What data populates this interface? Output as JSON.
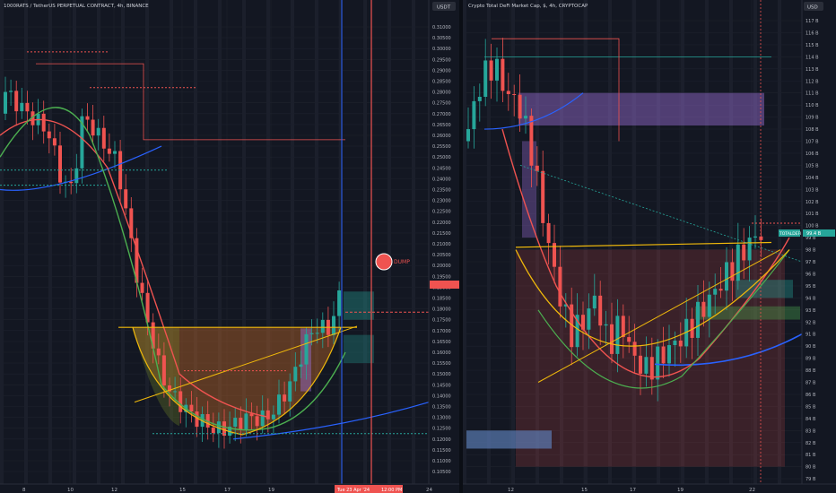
{
  "left_chart": {
    "title": "1000RATS / TetherUS PERPETUAL CONTRACT, 4h, BINANCE",
    "currency": "USDT",
    "price_ticks": [
      "0.31000",
      "0.30500",
      "0.30000",
      "0.29500",
      "0.29000",
      "0.28500",
      "0.28000",
      "0.27500",
      "0.27000",
      "0.26500",
      "0.26000",
      "0.25500",
      "0.25000",
      "0.24500",
      "0.24000",
      "0.23500",
      "0.23000",
      "0.22500",
      "0.22000",
      "0.21500",
      "0.21000",
      "0.20500",
      "0.20000",
      "0.19500",
      "0.19000",
      "0.18500",
      "0.18000",
      "0.17500",
      "0.17000",
      "0.16500",
      "0.16000",
      "0.15500",
      "0.15000",
      "0.14500",
      "0.14000",
      "0.13500",
      "0.13000",
      "0.12500",
      "0.12000",
      "0.11500",
      "0.11000",
      "0.10500"
    ],
    "time_ticks": [
      "8",
      "10",
      "12",
      "15",
      "17",
      "19",
      "22",
      "24"
    ],
    "crosshair_date": "Tue 23 Apr '24",
    "crosshair_time": "12:00 PM",
    "annotation": "DUMP",
    "current_price": "0.18500",
    "colors": {
      "up": "#26a69a",
      "down": "#ef5350",
      "accent": "#2962ff"
    }
  },
  "right_chart": {
    "title": "Crypto Total DeFi Market Cap, $, 4h, CRYPTOCAP",
    "currency": "USD",
    "price_ticks": [
      "117 B",
      "116 B",
      "115 B",
      "114 B",
      "113 B",
      "112 B",
      "111 B",
      "110 B",
      "109 B",
      "108 B",
      "107 B",
      "106 B",
      "105 B",
      "104 B",
      "103 B",
      "102 B",
      "101 B",
      "100 B",
      "99 B",
      "98 B",
      "97 B",
      "96 B",
      "95 B",
      "94 B",
      "93 B",
      "92 B",
      "91 B",
      "90 B",
      "89 B",
      "88 B",
      "87 B",
      "86 B",
      "85 B",
      "84 B",
      "83 B",
      "82 B",
      "81 B",
      "80 B",
      "79 B"
    ],
    "time_ticks": [
      "12",
      "15",
      "17",
      "19",
      "22"
    ],
    "symbol_badge": "TOTALDEFI",
    "badge_price": "99.4 B"
  },
  "chart_data": [
    {
      "type": "candlestick",
      "title": "1000RATS / TetherUS PERPETUAL CONTRACT, 4h, BINANCE",
      "ylabel": "USDT",
      "ylim": [
        0.105,
        0.31
      ],
      "x_ticks": [
        "8",
        "10",
        "12",
        "15",
        "17",
        "19",
        "22",
        "24"
      ],
      "series": [
        {
          "name": "close",
          "values": [
            0.28,
            0.275,
            0.27,
            0.266,
            0.26,
            0.24,
            0.235,
            0.27,
            0.262,
            0.255,
            0.248,
            0.22,
            0.19,
            0.17,
            0.15,
            0.14,
            0.135,
            0.13,
            0.127,
            0.124,
            0.125,
            0.128,
            0.13,
            0.129,
            0.132,
            0.14,
            0.15,
            0.165,
            0.172,
            0.17,
            0.185
          ]
        }
      ]
    },
    {
      "type": "candlestick",
      "title": "Crypto Total DeFi Market Cap, $, 4h, CRYPTOCAP",
      "ylabel": "USD",
      "ylim": [
        79,
        117
      ],
      "x_ticks": [
        "12",
        "15",
        "17",
        "19",
        "22"
      ],
      "series": [
        {
          "name": "close",
          "values": [
            108,
            112,
            113.5,
            111,
            110,
            106,
            100,
            95,
            91,
            92,
            94,
            90,
            92,
            89,
            88,
            89,
            90,
            91,
            92.5,
            94,
            95.5,
            97,
            98.5,
            99.4
          ]
        }
      ]
    }
  ]
}
